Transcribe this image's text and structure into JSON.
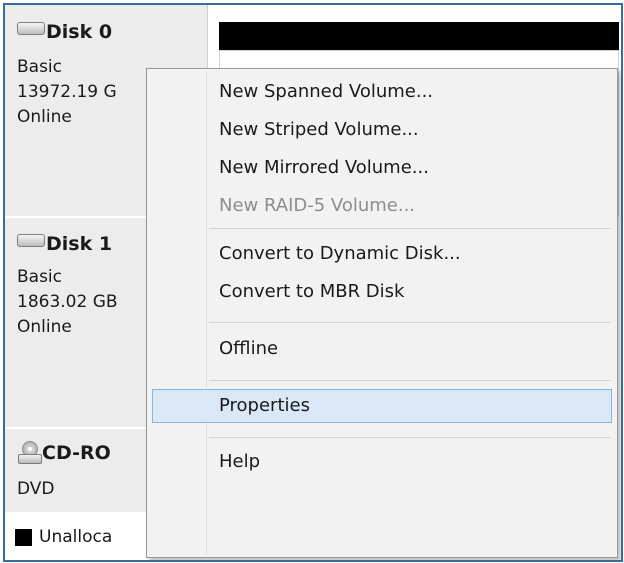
{
  "disks": [
    {
      "name": "Disk 0",
      "type": "Basic",
      "size": "13972.19 G",
      "status": "Online"
    },
    {
      "name": "Disk 1",
      "type": "Basic",
      "size": "1863.02 GB",
      "status": "Online"
    }
  ],
  "cdrom": {
    "name": "CD-RO",
    "type": "DVD"
  },
  "legend": {
    "label": "Unalloca",
    "color": "#000000"
  },
  "context_menu": {
    "items": [
      {
        "label": "New Spanned Volume...",
        "enabled": true
      },
      {
        "label": "New Striped Volume...",
        "enabled": true
      },
      {
        "label": "New Mirrored Volume...",
        "enabled": true
      },
      {
        "label": "New RAID-5 Volume...",
        "enabled": false
      },
      {
        "label": "Convert to Dynamic Disk...",
        "enabled": true
      },
      {
        "label": "Convert to MBR Disk",
        "enabled": true
      },
      {
        "label": "Offline",
        "enabled": true
      },
      {
        "label": "Properties",
        "enabled": true,
        "highlighted": true
      },
      {
        "label": "Help",
        "enabled": true
      }
    ]
  },
  "colors": {
    "frame_border": "#3c6a9c",
    "disk_panel_bg": "#ececec",
    "menu_bg": "#f2f2f2",
    "highlight_bg": "#d9e7f7",
    "highlight_border": "#8ab4e0",
    "disabled_text": "#8d8d8d"
  },
  "icons": {
    "disk": "hard-disk-icon",
    "cdrom": "cd-drive-icon"
  }
}
